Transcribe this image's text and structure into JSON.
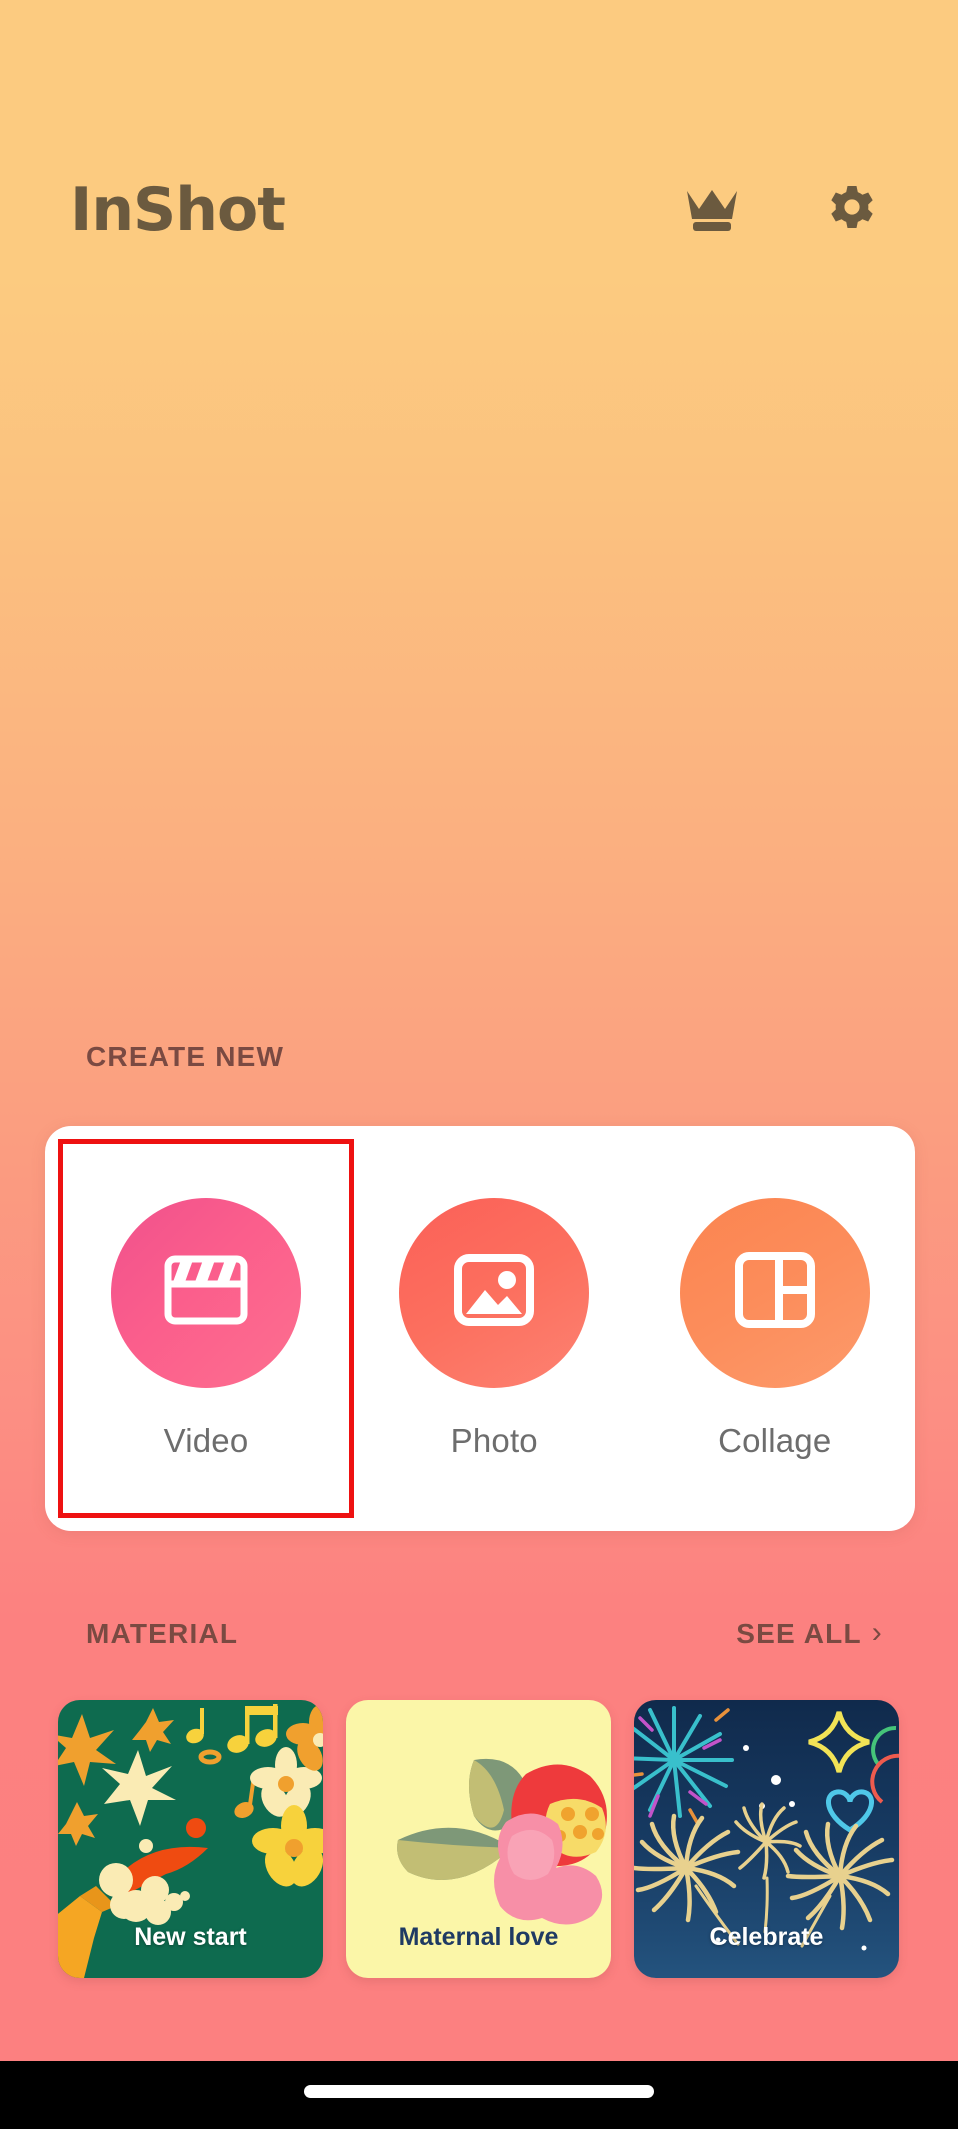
{
  "app": {
    "logo_text": "InShot",
    "logo_color": "#6B5A3F",
    "background_top_color": "#FCCB80",
    "background_bottom_color": "#FC8080"
  },
  "header": {
    "icons": [
      {
        "name": "crown-icon",
        "label": "Pro"
      },
      {
        "name": "gear-icon",
        "label": "Settings"
      }
    ]
  },
  "create_new": {
    "section_title": "CREATE NEW",
    "highlight_color": "#EE1111",
    "tiles": [
      {
        "label": "Video",
        "icon": "clapperboard-icon",
        "color": "#FB5E8C",
        "highlighted": true
      },
      {
        "label": "Photo",
        "icon": "image-icon",
        "color": "#FC6F5E",
        "highlighted": false
      },
      {
        "label": "Collage",
        "icon": "collage-grid-icon",
        "color": "#FC8D5B",
        "highlighted": false
      }
    ]
  },
  "material": {
    "section_title": "MATERIAL",
    "see_all_label": "SEE ALL",
    "see_all_chevron": "›",
    "cards": [
      {
        "title": "New start",
        "background": "#0E6B4F",
        "title_color": "#FFFFFF"
      },
      {
        "title": "Maternal love",
        "background": "#FBF6A8",
        "title_color": "#1F3A63"
      },
      {
        "title": "Celebrate",
        "background": "#173B63",
        "title_color": "#FFFFFF"
      }
    ]
  },
  "nav": {
    "home_indicator": "home-indicator"
  }
}
